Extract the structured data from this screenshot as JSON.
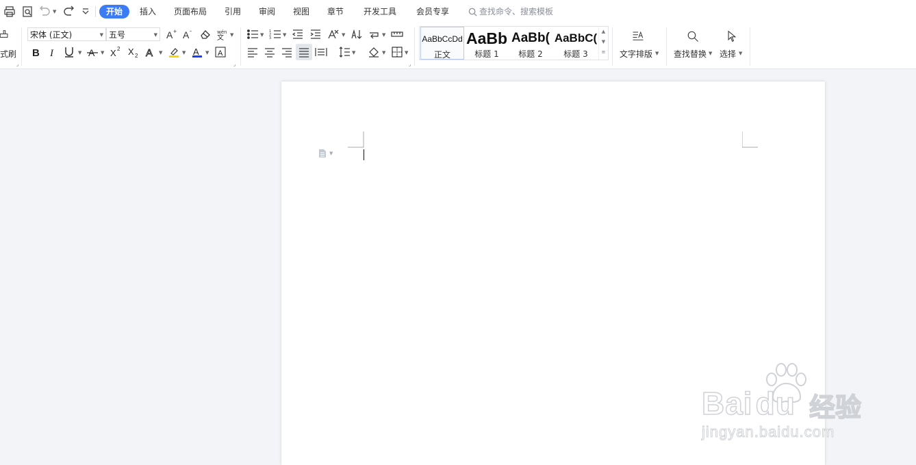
{
  "tabs": [
    {
      "label": "开始",
      "active": true
    },
    {
      "label": "插入"
    },
    {
      "label": "页面布局"
    },
    {
      "label": "引用"
    },
    {
      "label": "审阅"
    },
    {
      "label": "视图"
    },
    {
      "label": "章节"
    },
    {
      "label": "开发工具"
    },
    {
      "label": "会员专享"
    }
  ],
  "search_command": {
    "placeholder": "查找命令、搜索模板"
  },
  "ribbon": {
    "format_painter_label": "式刷",
    "font_name": "宋体 (正文)",
    "font_size": "五号",
    "styles": [
      {
        "preview": "AaBbCcDd",
        "name": "正文"
      },
      {
        "preview": "AaBb",
        "name": "标题 1"
      },
      {
        "preview": "AaBb(",
        "name": "标题 2"
      },
      {
        "preview": "AaBbC(",
        "name": "标题 3"
      }
    ],
    "text_layout_label": "文字排版",
    "find_replace_label": "查找替换",
    "select_label": "选择"
  },
  "watermark": {
    "brand": "Baidu",
    "brand_part1": "Bai",
    "brand_part2": "du",
    "cn": "经验",
    "url": "jingyan.baidu.com"
  },
  "colors": {
    "accent": "#3b7cf5",
    "highlight": "#f5d800",
    "font_color": "#1a3cff"
  }
}
